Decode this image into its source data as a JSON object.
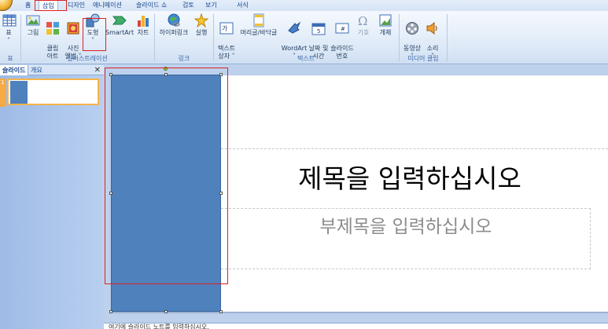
{
  "tabs": [
    {
      "label": "홈",
      "active": false
    },
    {
      "label": "삽입",
      "active": true
    },
    {
      "label": "디자인",
      "active": false
    },
    {
      "label": "애니메이션",
      "active": false
    },
    {
      "label": "슬라이드 쇼",
      "active": false
    },
    {
      "label": "검토",
      "active": false
    },
    {
      "label": "보기",
      "active": false
    },
    {
      "label": "서식",
      "active": false
    }
  ],
  "ribbon": {
    "buttons": {
      "table": "표",
      "table_arrow": "˅",
      "picture": "그림",
      "clipart": "클립\n아트",
      "album": "사진\n앨범 ˅",
      "shapes": "도형",
      "shapes_arrow": "˅",
      "smartart": "SmartArt",
      "chart": "차트",
      "hyperlink": "하이퍼링크",
      "action": "실행",
      "textbox": "텍스트\n상자 ˅",
      "headerfooter": "머리글/바닥글",
      "wordart": "WordArt\n˅",
      "datetime": "날짜 및\n시간",
      "slidenumber": "슬라이드\n번호",
      "symbol": "기호",
      "object": "개체",
      "movie": "동영상\n˅",
      "sound": "소리\n˅"
    },
    "groups": {
      "tables": "표",
      "illustrations": "일러스트레이션",
      "links": "링크",
      "text": "텍스트",
      "media": "미디어 클립"
    }
  },
  "leftpane": {
    "tab_slides": "슬라이드",
    "tab_outline": "개요",
    "close": "✕",
    "slide_number": "1"
  },
  "slide": {
    "title_placeholder": "제목을 입력하십시오",
    "subtitle_placeholder": "부제목을 입력하십시오"
  },
  "notes": {
    "placeholder": "여기에 슬라이드 노트를 입력하십시오."
  },
  "colors": {
    "accent_blue": "#4f81bd",
    "highlight_red": "#e02020",
    "ribbon_text": "#1e395b"
  }
}
